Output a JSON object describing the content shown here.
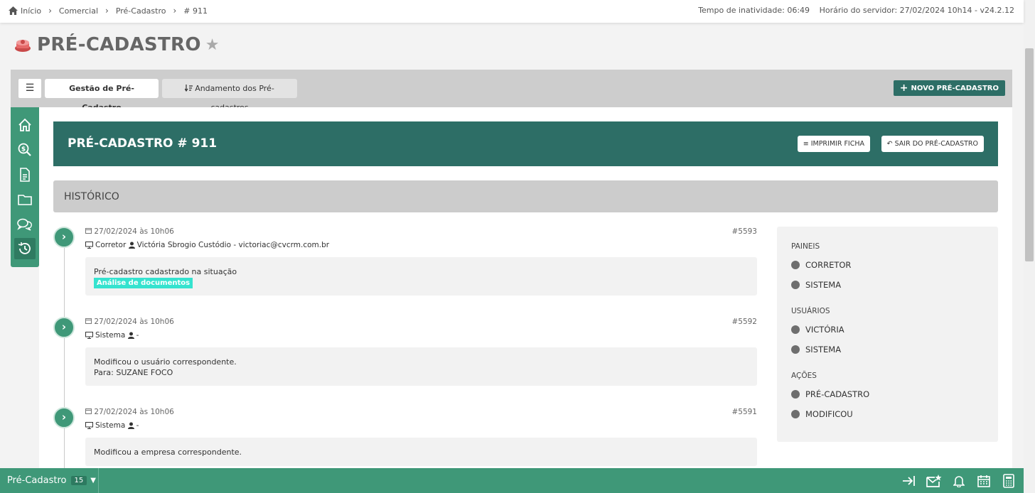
{
  "breadcrumb": [
    "Início",
    "Comercial",
    "Pré-Cadastro",
    "# 911"
  ],
  "top_info": {
    "inactivity": "Tempo de inatividade: 06:49",
    "server_time": "Horário do servidor: 27/02/2024 10h14 - v24.2.12"
  },
  "page": {
    "title": "PRÉ-CADASTRO"
  },
  "tabs": {
    "menu_icon": "☰",
    "active": "Gestão de Pré-Cadastro",
    "inactive": "Andamento dos Pré-cadastros",
    "new_button": "NOVO PRÉ-CADASTRO"
  },
  "sidebar_icons": [
    "home-icon",
    "search-money-icon",
    "document-icon",
    "folder-icon",
    "chat-icon",
    "history-icon"
  ],
  "header": {
    "title": "PRÉ-CADASTRO # 911",
    "print_button": "IMPRIMIR FICHA",
    "exit_button": "SAIR DO PRÉ-CADASTRO"
  },
  "history": {
    "title": "HISTÓRICO",
    "entries": [
      {
        "date": "27/02/2024 às 10h06",
        "id": "#5593",
        "origin": "Corretor",
        "user": "Victória Sbrogio Custódio - victoriac@cvcrm.com.br",
        "text": "Pré-cadastro cadastrado na situação",
        "badge": "Análise de documentos",
        "extra": ""
      },
      {
        "date": "27/02/2024 às 10h06",
        "id": "#5592",
        "origin": "Sistema",
        "user": "-",
        "text": "Modificou o usuário correspondente.",
        "badge": "",
        "extra": "Para: SUZANE FOCO"
      },
      {
        "date": "27/02/2024 às 10h06",
        "id": "#5591",
        "origin": "Sistema",
        "user": "-",
        "text": "Modificou a empresa correspondente.",
        "badge": "",
        "extra": ""
      }
    ]
  },
  "filters": {
    "paineis_title": "PAINEIS",
    "paineis": [
      "CORRETOR",
      "SISTEMA"
    ],
    "usuarios_title": "USUÁRIOS",
    "usuarios": [
      "VICTÓRIA",
      "SISTEMA"
    ],
    "acoes_title": "AÇÕES",
    "acoes": [
      "PRÉ-CADASTRO",
      "MODIFICOU"
    ]
  },
  "bottom": {
    "label": "Pré-Cadastro",
    "count": "15"
  },
  "colors": {
    "primary_dark": "#2d6e66",
    "primary": "#3f9878",
    "badge": "#35e3cf"
  }
}
